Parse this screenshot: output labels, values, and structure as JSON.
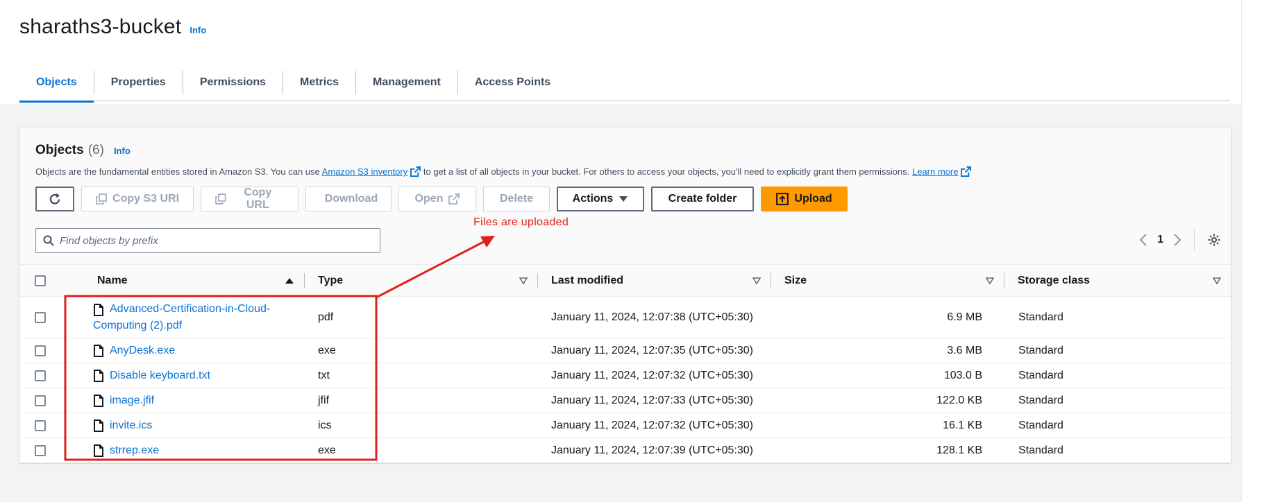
{
  "bucket": {
    "name": "sharaths3-bucket",
    "info": "Info"
  },
  "tabs": [
    {
      "label": "Objects"
    },
    {
      "label": "Properties"
    },
    {
      "label": "Permissions"
    },
    {
      "label": "Metrics"
    },
    {
      "label": "Management"
    },
    {
      "label": "Access Points"
    }
  ],
  "objects_panel": {
    "title": "Objects",
    "count": "(6)",
    "info": "Info",
    "desc_part1": "Objects are the fundamental entities stored in Amazon S3. You can use",
    "desc_link1": "Amazon S3 inventory",
    "desc_part2": "to get a list of all objects in your bucket. For others to access your objects, you'll need to explicitly grant them permissions.",
    "desc_link2": "Learn more"
  },
  "toolbar": {
    "copy_uri": "Copy S3 URI",
    "copy_url": "Copy URL",
    "download": "Download",
    "open": "Open",
    "delete": "Delete",
    "actions": "Actions",
    "create_folder": "Create folder",
    "upload": "Upload"
  },
  "search": {
    "placeholder": "Find objects by prefix",
    "value": ""
  },
  "pagination": {
    "current_page": "1"
  },
  "annotation": {
    "text": "Files are uploaded",
    "color": "#e0201b"
  },
  "table": {
    "columns": [
      "Name",
      "Type",
      "Last modified",
      "Size",
      "Storage class"
    ],
    "rows": [
      {
        "name_line1": "Advanced-Certification-in-Cloud-",
        "name_line2": "Computing (2).pdf",
        "type": "pdf",
        "modified": "January 11, 2024, 12:07:38 (UTC+05:30)",
        "size": "6.9 MB",
        "storage": "Standard"
      },
      {
        "name": "AnyDesk.exe",
        "type": "exe",
        "modified": "January 11, 2024, 12:07:35 (UTC+05:30)",
        "size": "3.6 MB",
        "storage": "Standard"
      },
      {
        "name": "Disable keyboard.txt",
        "type": "txt",
        "modified": "January 11, 2024, 12:07:32 (UTC+05:30)",
        "size": "103.0 B",
        "storage": "Standard"
      },
      {
        "name": "image.jfif",
        "type": "jfif",
        "modified": "January 11, 2024, 12:07:33 (UTC+05:30)",
        "size": "122.0 KB",
        "storage": "Standard"
      },
      {
        "name": "invite.ics",
        "type": "ics",
        "modified": "January 11, 2024, 12:07:32 (UTC+05:30)",
        "size": "16.1 KB",
        "storage": "Standard"
      },
      {
        "name": "strrep.exe",
        "type": "exe",
        "modified": "January 11, 2024, 12:07:39 (UTC+05:30)",
        "size": "128.1 KB",
        "storage": "Standard"
      }
    ]
  },
  "colors": {
    "link": "#0972d3",
    "primary_button": "#ff9900",
    "annotation": "#e0201b"
  }
}
